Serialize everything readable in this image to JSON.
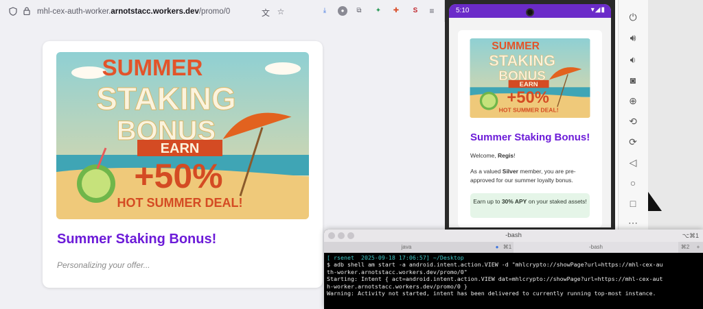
{
  "browser": {
    "url_prefix": "mhl-cex-auth-worker.",
    "url_domain": "arnotstacc.workers.dev",
    "url_path": "/promo/0",
    "card": {
      "title": "Summer Staking Bonus!",
      "status": "Personalizing your offer..."
    }
  },
  "promo_image": {
    "line1": "SUMMER",
    "line2": "STAKING",
    "line3": "BONUS",
    "earn": "EARN",
    "percent": "+50%",
    "deal": "HOT SUMMER DEAL!"
  },
  "phone": {
    "time": "5:10",
    "status_icons": "▾◢▮",
    "title": "Summer Staking Bonus!",
    "welcome_prefix": "Welcome, ",
    "user_name": "Regis",
    "welcome_suffix": "!",
    "desc_prefix": "As a valued ",
    "tier": "Silver",
    "desc_suffix": " member, you are pre-approved for our summer loyalty bonus.",
    "apy_prefix": "Earn up to ",
    "apy_value": "30% APY",
    "apy_suffix": " on your staked assets!"
  },
  "terminal": {
    "title": "-bash",
    "shortcut": "⌥⌘1",
    "tab1": "java",
    "tab1_shortcut": "⌘1",
    "tab2": "-bash",
    "tab2_shortcut": "⌘2",
    "line1_host": "[ rsenet  2025-09-18 17:06:57] ~/Desktop",
    "line2": "$ adb shell am start -a android.intent.action.VIEW -d \"mhlcrypto://showPage?url=https://mhl-cex-au",
    "line3": "th-worker.arnotstacc.workers.dev/promo/0\"",
    "line4": "Starting: Intent { act=android.intent.action.VIEW dat=mhlcrypto://showPage?url=https://mhl-cex-aut",
    "line5": "h-worker.arnotstacc.workers.dev/promo/0 }",
    "line6": "Warning: Activity not started, intent has been delivered to currently running top-most instance."
  },
  "colors": {
    "title_purple": "#6c1bd8",
    "status_bar_purple": "#6b2bc9",
    "apy_green_bg": "#e5f5e8"
  }
}
